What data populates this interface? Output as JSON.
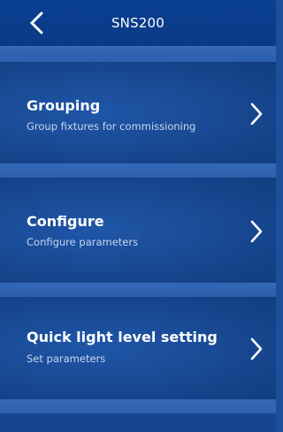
{
  "header": {
    "title": "SNS200",
    "back_icon": "chevron-left-icon"
  },
  "menu": {
    "items": [
      {
        "title": "Grouping",
        "subtitle": "Group fixtures for commissioning",
        "icon": "chevron-right-icon"
      },
      {
        "title": "Configure",
        "subtitle": "Configure parameters",
        "icon": "chevron-right-icon"
      },
      {
        "title": "Quick light level setting",
        "subtitle": "Set parameters",
        "icon": "chevron-right-icon"
      }
    ]
  },
  "colors": {
    "header_bg": "#0a3f93",
    "row_bg": "#184891",
    "divider_bg": "#3469b8",
    "text": "#ffffff",
    "subtitle_text": "#c9d6ec"
  }
}
